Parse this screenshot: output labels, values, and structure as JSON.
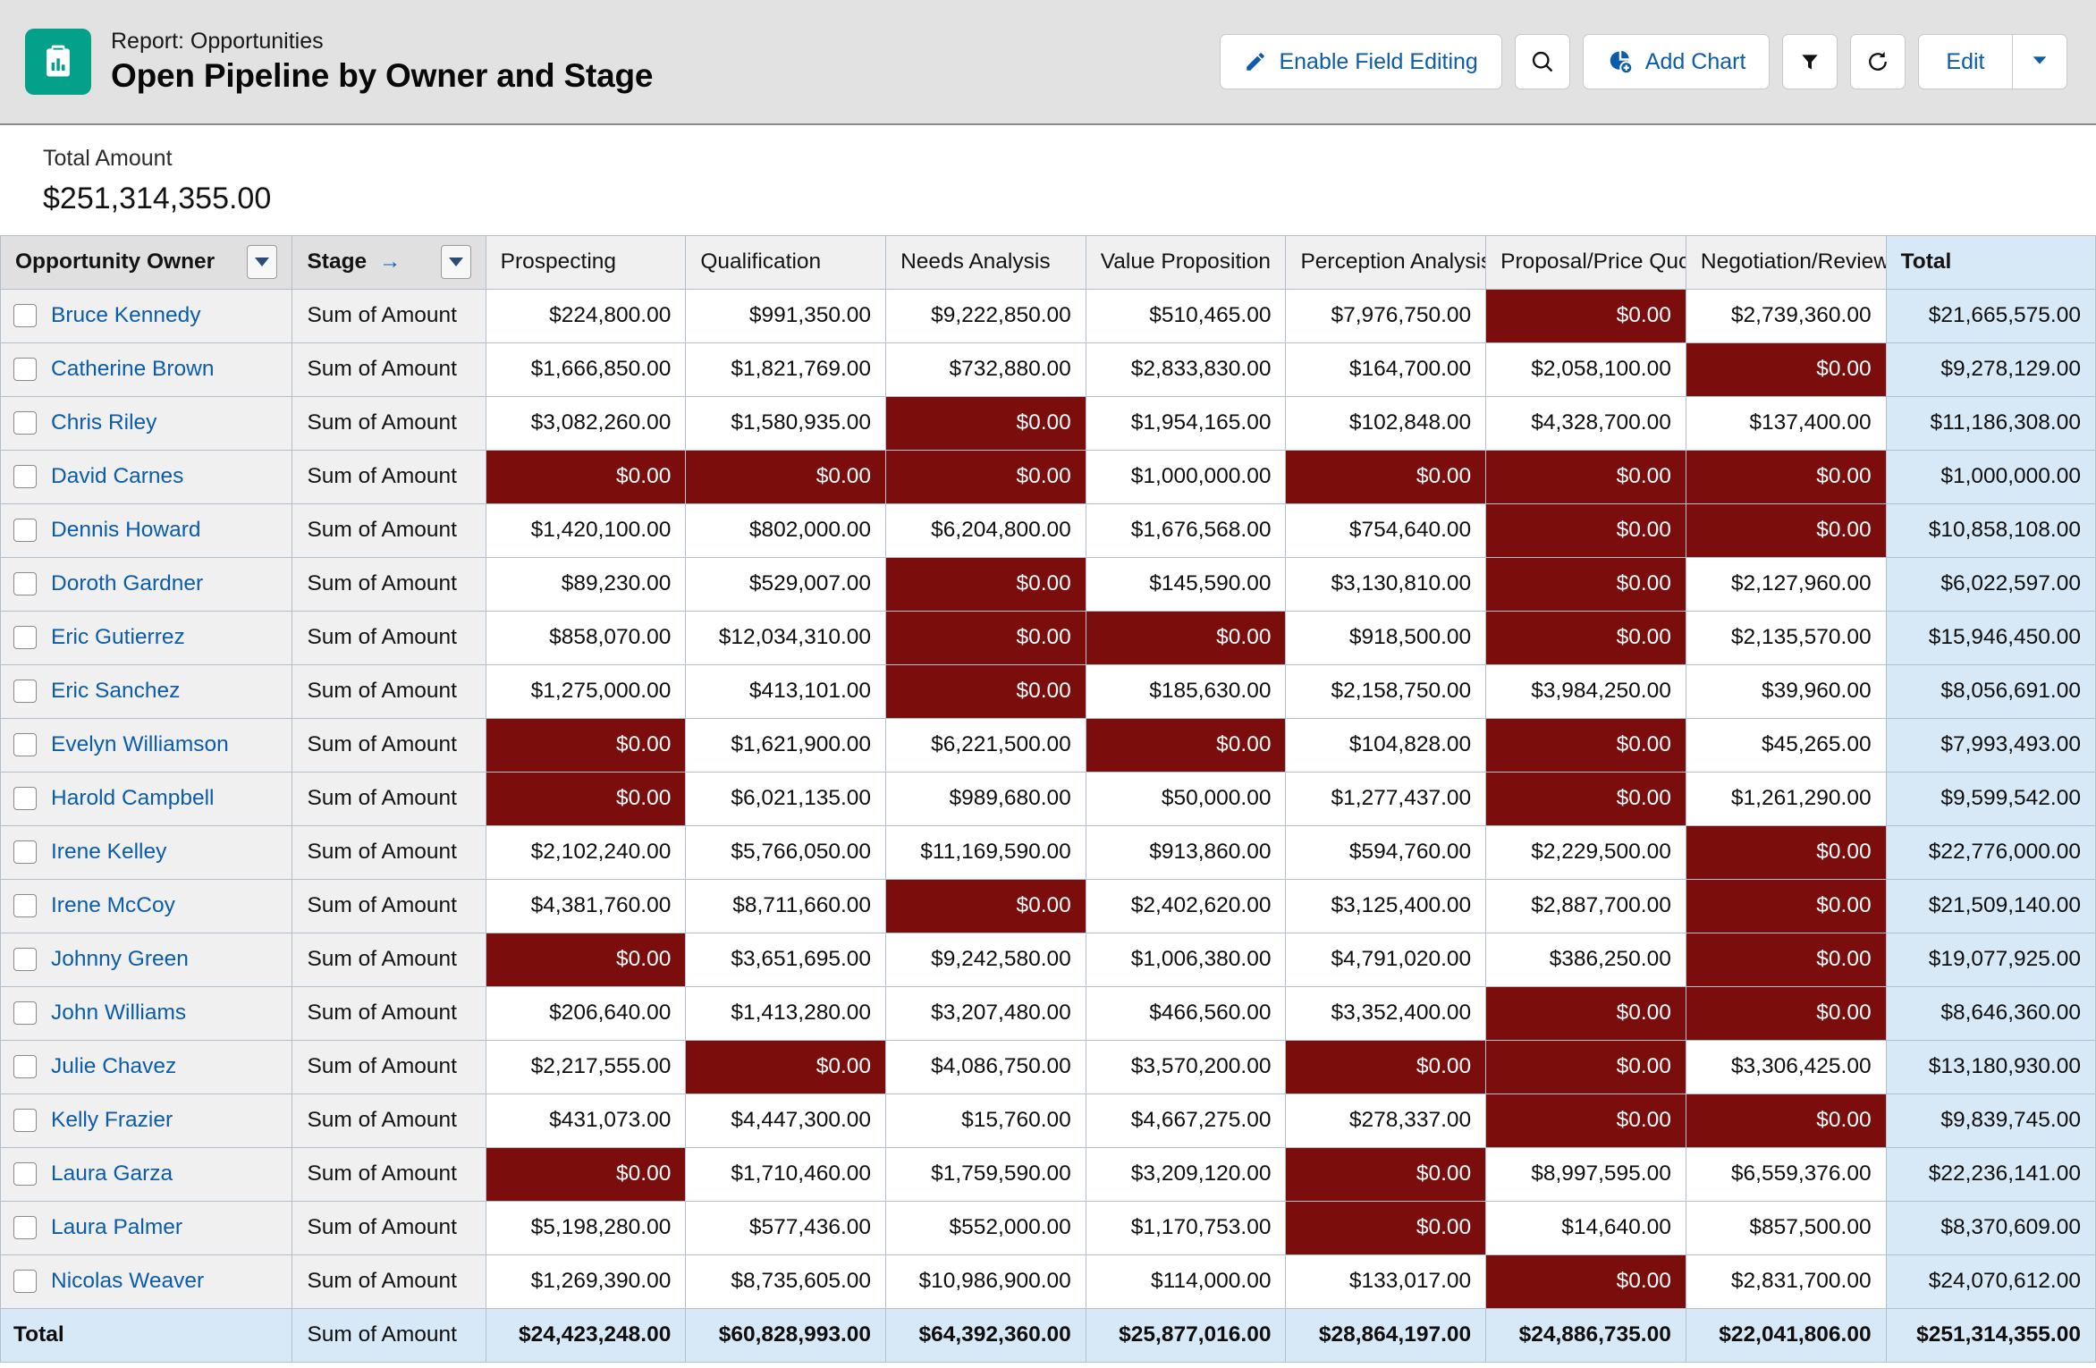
{
  "header": {
    "eyebrow": "Report: Opportunities",
    "title": "Open Pipeline by Owner and Stage",
    "app_icon": "report-clipboard-icon",
    "buttons": {
      "enable_field_editing": "Enable Field Editing",
      "search": "search-icon",
      "add_chart": "Add Chart",
      "filter": "filter-icon",
      "refresh": "refresh-icon",
      "edit": "Edit",
      "edit_more": "chevron-down-icon"
    }
  },
  "summary": {
    "label": "Total Amount",
    "value": "$251,314,355.00"
  },
  "table": {
    "headers": {
      "owner": "Opportunity Owner",
      "stage": "Stage",
      "stage_arrow": "→",
      "columns": [
        "Prospecting",
        "Qualification",
        "Needs Analysis",
        "Value Proposition",
        "Perception Analysis",
        "Proposal/Price Quote",
        "Negotiation/Review"
      ],
      "total": "Total"
    },
    "stage_measure": "Sum of Amount",
    "zero_value": "$0.00",
    "rows": [
      {
        "owner": "Bruce Kennedy",
        "values": [
          "$224,800.00",
          "$991,350.00",
          "$9,222,850.00",
          "$510,465.00",
          "$7,976,750.00",
          "$0.00",
          "$2,739,360.00"
        ],
        "total": "$21,665,575.00"
      },
      {
        "owner": "Catherine Brown",
        "values": [
          "$1,666,850.00",
          "$1,821,769.00",
          "$732,880.00",
          "$2,833,830.00",
          "$164,700.00",
          "$2,058,100.00",
          "$0.00"
        ],
        "total": "$9,278,129.00"
      },
      {
        "owner": "Chris Riley",
        "values": [
          "$3,082,260.00",
          "$1,580,935.00",
          "$0.00",
          "$1,954,165.00",
          "$102,848.00",
          "$4,328,700.00",
          "$137,400.00"
        ],
        "total": "$11,186,308.00"
      },
      {
        "owner": "David Carnes",
        "values": [
          "$0.00",
          "$0.00",
          "$0.00",
          "$1,000,000.00",
          "$0.00",
          "$0.00",
          "$0.00"
        ],
        "total": "$1,000,000.00"
      },
      {
        "owner": "Dennis Howard",
        "values": [
          "$1,420,100.00",
          "$802,000.00",
          "$6,204,800.00",
          "$1,676,568.00",
          "$754,640.00",
          "$0.00",
          "$0.00"
        ],
        "total": "$10,858,108.00"
      },
      {
        "owner": "Doroth Gardner",
        "values": [
          "$89,230.00",
          "$529,007.00",
          "$0.00",
          "$145,590.00",
          "$3,130,810.00",
          "$0.00",
          "$2,127,960.00"
        ],
        "total": "$6,022,597.00"
      },
      {
        "owner": "Eric Gutierrez",
        "values": [
          "$858,070.00",
          "$12,034,310.00",
          "$0.00",
          "$0.00",
          "$918,500.00",
          "$0.00",
          "$2,135,570.00"
        ],
        "total": "$15,946,450.00"
      },
      {
        "owner": "Eric Sanchez",
        "values": [
          "$1,275,000.00",
          "$413,101.00",
          "$0.00",
          "$185,630.00",
          "$2,158,750.00",
          "$3,984,250.00",
          "$39,960.00"
        ],
        "total": "$8,056,691.00"
      },
      {
        "owner": "Evelyn Williamson",
        "values": [
          "$0.00",
          "$1,621,900.00",
          "$6,221,500.00",
          "$0.00",
          "$104,828.00",
          "$0.00",
          "$45,265.00"
        ],
        "total": "$7,993,493.00"
      },
      {
        "owner": "Harold Campbell",
        "values": [
          "$0.00",
          "$6,021,135.00",
          "$989,680.00",
          "$50,000.00",
          "$1,277,437.00",
          "$0.00",
          "$1,261,290.00"
        ],
        "total": "$9,599,542.00"
      },
      {
        "owner": "Irene Kelley",
        "values": [
          "$2,102,240.00",
          "$5,766,050.00",
          "$11,169,590.00",
          "$913,860.00",
          "$594,760.00",
          "$2,229,500.00",
          "$0.00"
        ],
        "total": "$22,776,000.00"
      },
      {
        "owner": "Irene McCoy",
        "values": [
          "$4,381,760.00",
          "$8,711,660.00",
          "$0.00",
          "$2,402,620.00",
          "$3,125,400.00",
          "$2,887,700.00",
          "$0.00"
        ],
        "total": "$21,509,140.00"
      },
      {
        "owner": "Johnny Green",
        "values": [
          "$0.00",
          "$3,651,695.00",
          "$9,242,580.00",
          "$1,006,380.00",
          "$4,791,020.00",
          "$386,250.00",
          "$0.00"
        ],
        "total": "$19,077,925.00"
      },
      {
        "owner": "John Williams",
        "values": [
          "$206,640.00",
          "$1,413,280.00",
          "$3,207,480.00",
          "$466,560.00",
          "$3,352,400.00",
          "$0.00",
          "$0.00"
        ],
        "total": "$8,646,360.00"
      },
      {
        "owner": "Julie Chavez",
        "values": [
          "$2,217,555.00",
          "$0.00",
          "$4,086,750.00",
          "$3,570,200.00",
          "$0.00",
          "$0.00",
          "$3,306,425.00"
        ],
        "total": "$13,180,930.00"
      },
      {
        "owner": "Kelly Frazier",
        "values": [
          "$431,073.00",
          "$4,447,300.00",
          "$15,760.00",
          "$4,667,275.00",
          "$278,337.00",
          "$0.00",
          "$0.00"
        ],
        "total": "$9,839,745.00"
      },
      {
        "owner": "Laura Garza",
        "values": [
          "$0.00",
          "$1,710,460.00",
          "$1,759,590.00",
          "$3,209,120.00",
          "$0.00",
          "$8,997,595.00",
          "$6,559,376.00"
        ],
        "total": "$22,236,141.00"
      },
      {
        "owner": "Laura Palmer",
        "values": [
          "$5,198,280.00",
          "$577,436.00",
          "$552,000.00",
          "$1,170,753.00",
          "$0.00",
          "$14,640.00",
          "$857,500.00"
        ],
        "total": "$8,370,609.00"
      },
      {
        "owner": "Nicolas Weaver",
        "values": [
          "$1,269,390.00",
          "$8,735,605.00",
          "$10,986,900.00",
          "$114,000.00",
          "$133,017.00",
          "$0.00",
          "$2,831,700.00"
        ],
        "total": "$24,070,612.00"
      }
    ],
    "footer": {
      "label": "Total",
      "stage_measure": "Sum of Amount",
      "values": [
        "$24,423,248.00",
        "$60,828,993.00",
        "$64,392,360.00",
        "$25,877,016.00",
        "$28,864,197.00",
        "$24,886,735.00",
        "$22,041,806.00"
      ],
      "total": "$251,314,355.00"
    }
  },
  "colors": {
    "accent_teal": "#03a08a",
    "link_blue": "#0b5cab",
    "zero_red": "#7b0d0d",
    "total_blue": "#d7e9f7"
  }
}
